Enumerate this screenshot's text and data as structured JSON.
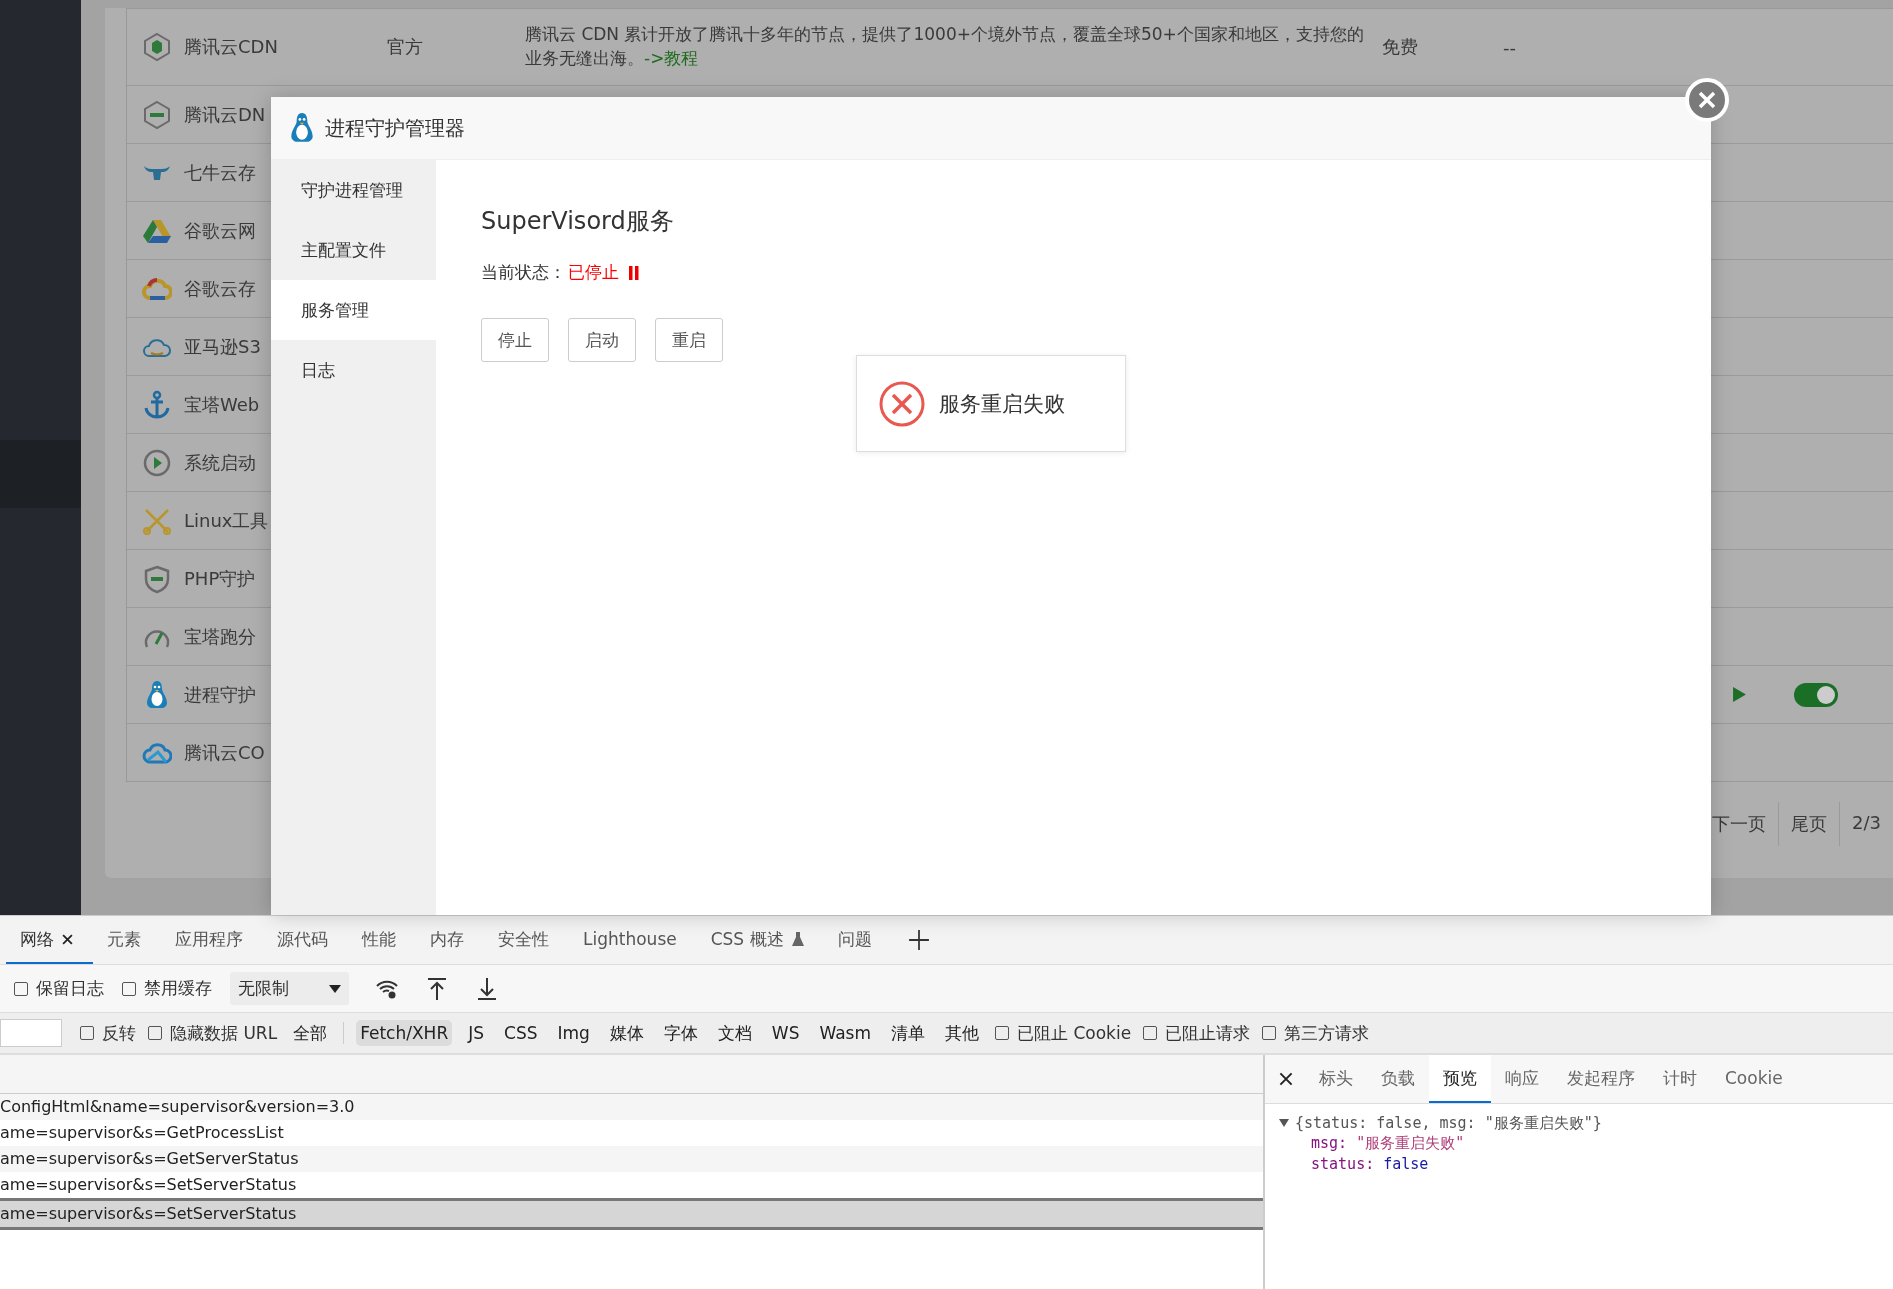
{
  "plugin_table": {
    "rows": [
      {
        "name": "腾讯云CDN",
        "type": "官方",
        "description": "腾讯云 CDN 累计开放了腾讯十多年的节点，提供了1000+个境外节点，覆盖全球50+个国家和地区，支持您的业务无缝出海。",
        "link": "->教程",
        "price": "免费",
        "expiry": "--"
      },
      {
        "name": "腾讯云DN"
      },
      {
        "name": "七牛云存"
      },
      {
        "name": "谷歌云网"
      },
      {
        "name": "谷歌云存"
      },
      {
        "name": "亚马逊S3"
      },
      {
        "name": "宝塔Web"
      },
      {
        "name": "系统启动"
      },
      {
        "name": "Linux工具"
      },
      {
        "name": "PHP守护"
      },
      {
        "name": "宝塔跑分"
      },
      {
        "name": "进程守护",
        "on": true
      },
      {
        "name": "腾讯云CO"
      }
    ],
    "pagination": [
      "下一页",
      "尾页",
      "2/3"
    ]
  },
  "dialog": {
    "title": "进程守护管理器",
    "nav": [
      {
        "label": "守护进程管理",
        "selected": false
      },
      {
        "label": "主配置文件",
        "selected": false
      },
      {
        "label": "服务管理",
        "selected": true
      },
      {
        "label": "日志",
        "selected": false
      }
    ],
    "heading": "SuperVisord服务",
    "status_label": "当前状态：",
    "status_value": "已停止",
    "running": false,
    "buttons": [
      "停止",
      "启动",
      "重启"
    ],
    "toast": "服务重启失败"
  },
  "devtools": {
    "tabs": [
      {
        "label": "网络",
        "selected": true,
        "closable": true
      },
      {
        "label": "元素",
        "selected": false,
        "closable": false
      },
      {
        "label": "应用程序",
        "selected": false,
        "closable": false
      },
      {
        "label": "源代码",
        "selected": false,
        "closable": false
      },
      {
        "label": "性能",
        "selected": false,
        "closable": false
      },
      {
        "label": "内存",
        "selected": false,
        "closable": false
      },
      {
        "label": "安全性",
        "selected": false,
        "closable": false
      },
      {
        "label": "Lighthouse",
        "selected": false,
        "closable": false
      },
      {
        "label": "CSS 概述",
        "selected": false,
        "closable": false
      },
      {
        "label": "问题",
        "selected": false,
        "closable": false
      }
    ],
    "toolbar": {
      "checkboxes": [
        {
          "label": "保留日志",
          "checked": false
        },
        {
          "label": "禁用缓存",
          "checked": false
        }
      ],
      "throttle": "无限制"
    },
    "filter": {
      "options": [
        {
          "label": "反转",
          "checked": false
        },
        {
          "label": "隐藏数据 URL",
          "checked": false
        }
      ],
      "types": [
        {
          "label": "全部",
          "selected": false
        },
        {
          "label": "Fetch/XHR",
          "selected": true
        },
        {
          "label": "JS",
          "selected": false
        },
        {
          "label": "CSS",
          "selected": false
        },
        {
          "label": "Img",
          "selected": false
        },
        {
          "label": "媒体",
          "selected": false
        },
        {
          "label": "字体",
          "selected": false
        },
        {
          "label": "文档",
          "selected": false
        },
        {
          "label": "WS",
          "selected": false
        },
        {
          "label": "Wasm",
          "selected": false
        },
        {
          "label": "清单",
          "selected": false
        },
        {
          "label": "其他",
          "selected": false
        }
      ],
      "blocks": [
        {
          "label": "已阻止 Cookie",
          "checked": false
        },
        {
          "label": "已阻止请求",
          "checked": false
        },
        {
          "label": "第三方请求",
          "checked": false
        }
      ]
    },
    "requests": [
      {
        "url": "ConfigHtml&name=supervisor&version=3.0",
        "selected": false
      },
      {
        "url": "ame=supervisor&s=GetProcessList",
        "selected": false
      },
      {
        "url": "ame=supervisor&s=GetServerStatus",
        "selected": false
      },
      {
        "url": "ame=supervisor&s=SetServerStatus",
        "selected": false
      },
      {
        "url": "ame=supervisor&s=SetServerStatus",
        "selected": true
      }
    ],
    "detail_tabs": [
      {
        "label": "标头",
        "selected": false
      },
      {
        "label": "负载",
        "selected": false
      },
      {
        "label": "预览",
        "selected": true
      },
      {
        "label": "响应",
        "selected": false
      },
      {
        "label": "发起程序",
        "selected": false
      },
      {
        "label": "计时",
        "selected": false
      },
      {
        "label": "Cookie",
        "selected": false
      }
    ],
    "preview": {
      "expanded": true,
      "summary": "{status: false, msg: \"服务重启失败\"}",
      "fields": [
        {
          "key": "msg:",
          "value": "\"服务重启失败\"",
          "kind": "string"
        },
        {
          "key": "status:",
          "value": "false",
          "kind": "boolean"
        }
      ]
    }
  }
}
